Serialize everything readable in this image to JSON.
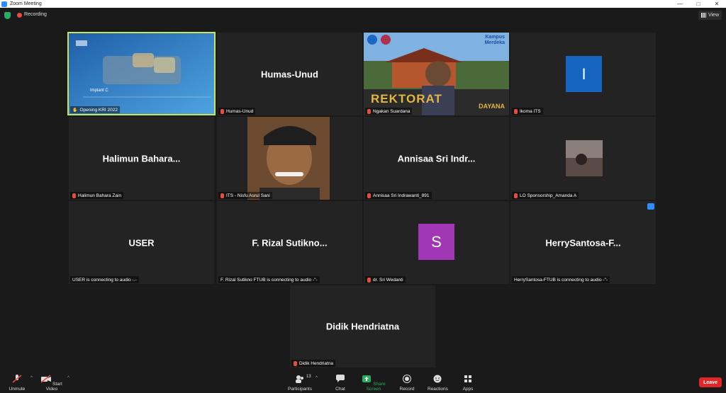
{
  "window": {
    "title": "Zoom Meeting",
    "min": "—",
    "max": "□",
    "close": "✕"
  },
  "topbar": {
    "recording": "Recording",
    "view": "View"
  },
  "tiles": [
    {
      "label": "Opening KRI 2022",
      "slide_title": "Implant C"
    },
    {
      "big": "Humas-Unud",
      "label": "Humas-Unud"
    },
    {
      "label": "Ngakan Suardana",
      "banner": "REKTORAT",
      "banner2": "DAYANA",
      "campus": "Kampus Merdeka"
    },
    {
      "label": "Ikoma ITS",
      "initial": "I"
    },
    {
      "big": "Halimun  Bahara...",
      "label": "Halimun Bahara Zain"
    },
    {
      "label": "ITS - Nisfu Asrul Sani"
    },
    {
      "big": "Annisaa Sri Indr...",
      "label": "Annisaa Sri Indrawanti_891"
    },
    {
      "label": "LO Sponsorship_Amanda A"
    },
    {
      "big": "USER",
      "label": "USER is connecting to audio -.-"
    },
    {
      "big": "F. Rizal Sutikno...",
      "label": "F. Rizal Sutikno FTUB is connecting to audio -\"-"
    },
    {
      "label": "dr. Sri Wedanti",
      "initial": "S"
    },
    {
      "big": "HerrySantosa-F...",
      "label": "HerrySantosa-FTUB is connecting to audio -\"-"
    },
    {
      "big": "Didik Hendriatna",
      "label": "Didik Hendriatna"
    }
  ],
  "toolbar": {
    "unmute": "Unmute",
    "start_video": "Start Video",
    "participants": "Participants",
    "participants_count": "13",
    "chat": "Chat",
    "share": "Share Screen",
    "record": "Record",
    "reactions": "Reactions",
    "apps": "Apps",
    "leave": "Leave"
  },
  "colors": {
    "accent": "#2d8cff",
    "active_speaker": "#c8e65a",
    "leave": "#e02828",
    "share": "#27ae60"
  }
}
